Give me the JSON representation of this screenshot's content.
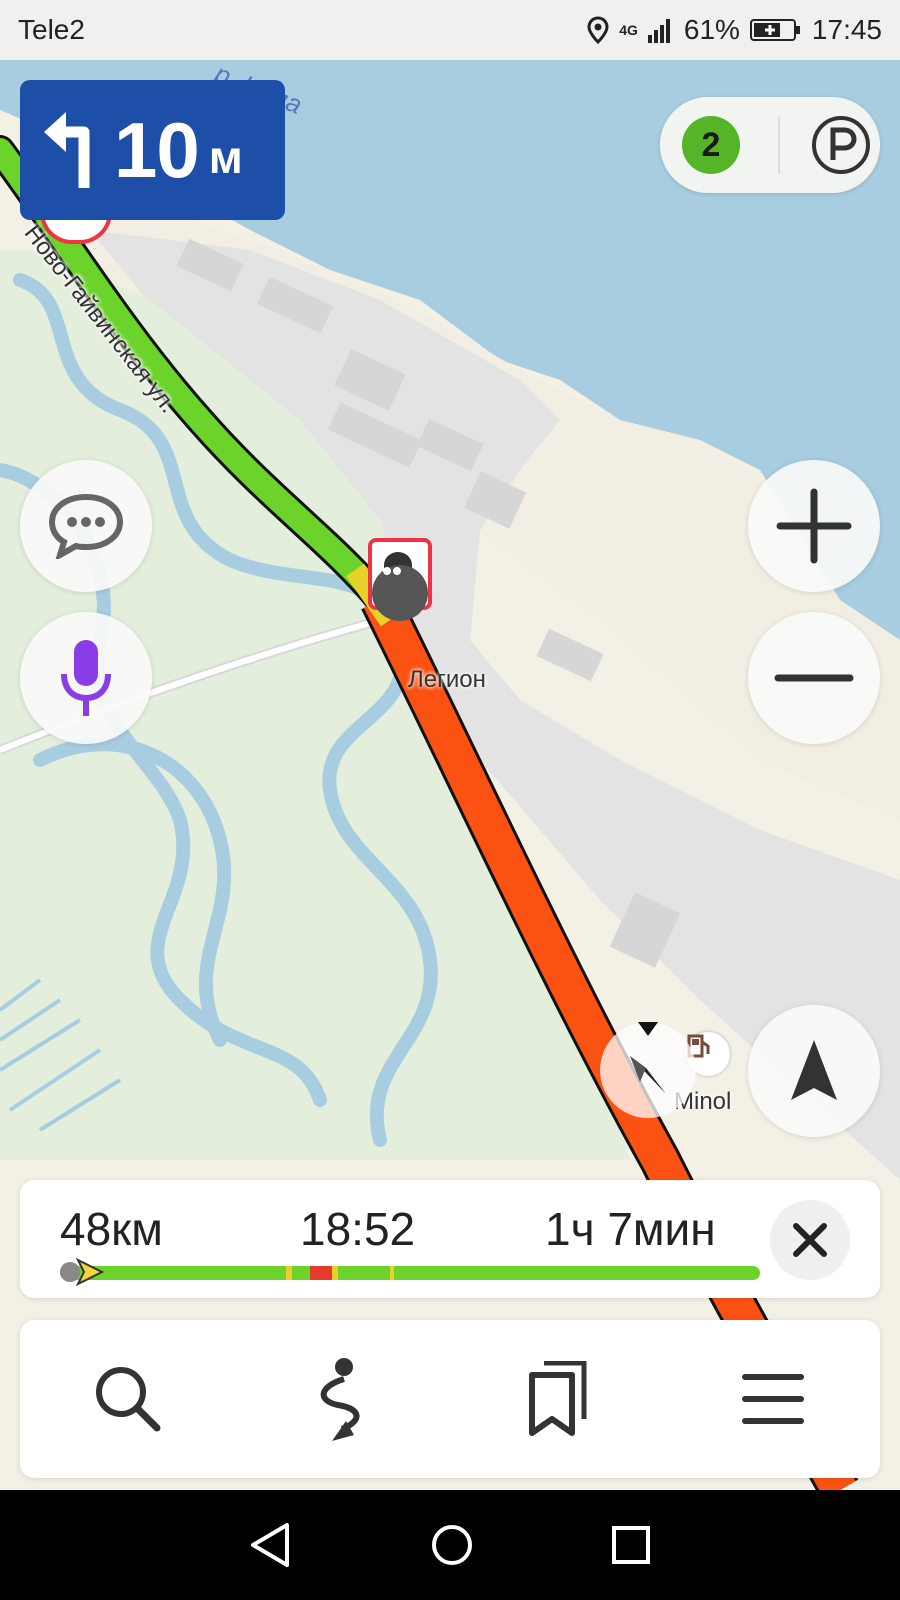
{
  "status_bar": {
    "carrier": "Tele2",
    "network": "4G",
    "battery": "61%",
    "time": "17:45"
  },
  "map": {
    "river_label": "р. Кама",
    "street_label": "Ново-Гайвинская ул.",
    "poi_label": "Легион",
    "fuel_label": "Minol",
    "colors": {
      "water": "#a8cde0",
      "land": "#f3f0e6",
      "park": "#e4eedc",
      "industrial": "#e3e3e3",
      "route_jam": "#fb5213",
      "route_free": "#6bd32a"
    }
  },
  "maneuver": {
    "icon": "turn-left-icon",
    "distance": "10",
    "unit": "м"
  },
  "traffic": {
    "level": "2",
    "parking_icon": "parking-icon"
  },
  "route": {
    "distance": "48км",
    "arrival": "18:52",
    "duration": "1ч 7мин",
    "close_icon": "close-icon"
  },
  "toolbar": {
    "items": [
      {
        "icon": "search-icon"
      },
      {
        "icon": "route-icon"
      },
      {
        "icon": "bookmarks-icon"
      },
      {
        "icon": "menu-icon"
      }
    ]
  }
}
